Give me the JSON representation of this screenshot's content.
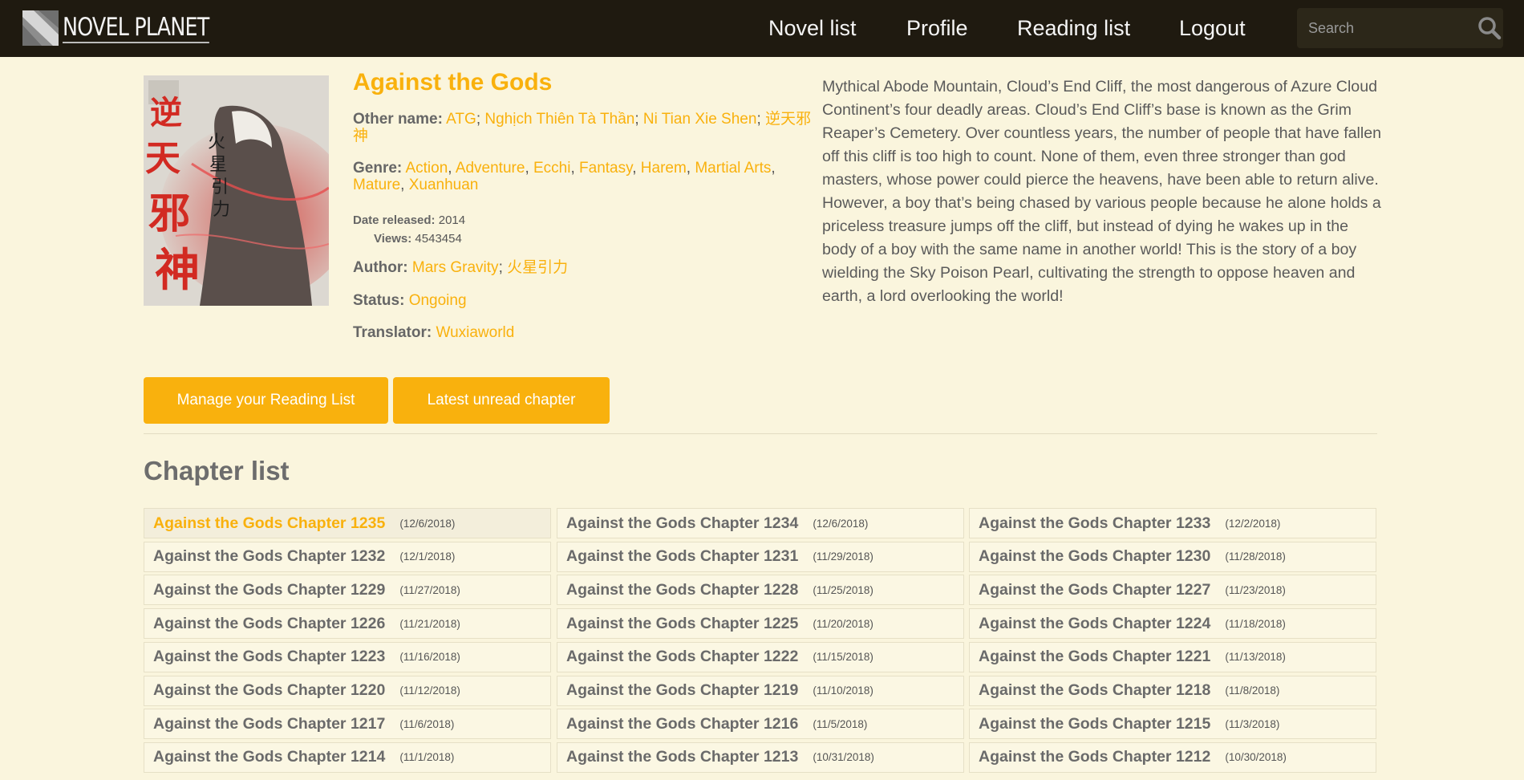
{
  "header": {
    "logo_text": "NOVEL PLANET",
    "nav": [
      "Novel list",
      "Profile",
      "Reading list",
      "Logout"
    ],
    "search_placeholder": "Search"
  },
  "novel": {
    "title": "Against the Gods",
    "other_name_label": "Other name:",
    "other_names": [
      "ATG",
      "Nghịch Thiên Tà Thần",
      "Ni Tian Xie Shen",
      "逆天邪神"
    ],
    "genre_label": "Genre:",
    "genres": [
      "Action",
      "Adventure",
      "Ecchi",
      "Fantasy",
      "Harem",
      "Martial Arts",
      "Mature",
      "Xuanhuan"
    ],
    "date_label": "Date released:",
    "date": "2014",
    "views_label": "Views:",
    "views": "4543454",
    "author_label": "Author:",
    "authors": [
      "Mars Gravity",
      "火星引力"
    ],
    "status_label": "Status:",
    "status": "Ongoing",
    "translator_label": "Translator:",
    "translator": "Wuxiaworld",
    "synopsis": "Mythical Abode Mountain, Cloud’s End Cliff, the most dangerous of Azure Cloud Continent’s four deadly areas. Cloud’s End Cliff’s base is known as the Grim Reaper’s Cemetery. Over countless years, the number of people that have fallen off this cliff is too high to count. None of them, even three stronger than god masters, whose power could pierce the heavens, have been able to return alive. However, a boy that’s being chased by various people because he alone holds a priceless treasure jumps off the cliff, but instead of dying he wakes up in the body of a boy with the same name in another world! This is the story of a boy wielding the Sky Poison Pearl, cultivating the strength to oppose heaven and earth, a lord overlooking the world!"
  },
  "buttons": {
    "manage": "Manage your Reading List",
    "latest": "Latest unread chapter"
  },
  "chapter_section": {
    "title": "Chapter list",
    "chapters": [
      {
        "title": "Against the Gods Chapter 1235",
        "date": "(12/6/2018)",
        "active": true
      },
      {
        "title": "Against the Gods Chapter 1234",
        "date": "(12/6/2018)"
      },
      {
        "title": "Against the Gods Chapter 1233",
        "date": "(12/2/2018)"
      },
      {
        "title": "Against the Gods Chapter 1232",
        "date": "(12/1/2018)"
      },
      {
        "title": "Against the Gods Chapter 1231",
        "date": "(11/29/2018)"
      },
      {
        "title": "Against the Gods Chapter 1230",
        "date": "(11/28/2018)"
      },
      {
        "title": "Against the Gods Chapter 1229",
        "date": "(11/27/2018)"
      },
      {
        "title": "Against the Gods Chapter 1228",
        "date": "(11/25/2018)"
      },
      {
        "title": "Against the Gods Chapter 1227",
        "date": "(11/23/2018)"
      },
      {
        "title": "Against the Gods Chapter 1226",
        "date": "(11/21/2018)"
      },
      {
        "title": "Against the Gods Chapter 1225",
        "date": "(11/20/2018)"
      },
      {
        "title": "Against the Gods Chapter 1224",
        "date": "(11/18/2018)"
      },
      {
        "title": "Against the Gods Chapter 1223",
        "date": "(11/16/2018)"
      },
      {
        "title": "Against the Gods Chapter 1222",
        "date": "(11/15/2018)"
      },
      {
        "title": "Against the Gods Chapter 1221",
        "date": "(11/13/2018)"
      },
      {
        "title": "Against the Gods Chapter 1220",
        "date": "(11/12/2018)"
      },
      {
        "title": "Against the Gods Chapter 1219",
        "date": "(11/10/2018)"
      },
      {
        "title": "Against the Gods Chapter 1218",
        "date": "(11/8/2018)"
      },
      {
        "title": "Against the Gods Chapter 1217",
        "date": "(11/6/2018)"
      },
      {
        "title": "Against the Gods Chapter 1216",
        "date": "(11/5/2018)"
      },
      {
        "title": "Against the Gods Chapter 1215",
        "date": "(11/3/2018)"
      },
      {
        "title": "Against the Gods Chapter 1214",
        "date": "(11/1/2018)"
      },
      {
        "title": "Against the Gods Chapter 1213",
        "date": "(10/31/2018)"
      },
      {
        "title": "Against the Gods Chapter 1212",
        "date": "(10/30/2018)"
      }
    ]
  },
  "colors": {
    "accent": "#f9b10d",
    "header_bg": "#1f1a10",
    "page_bg": "#faf5dd"
  },
  "icons": {
    "logo": "diagonal-stripes-logo-icon",
    "search": "magnifier-search-icon"
  }
}
